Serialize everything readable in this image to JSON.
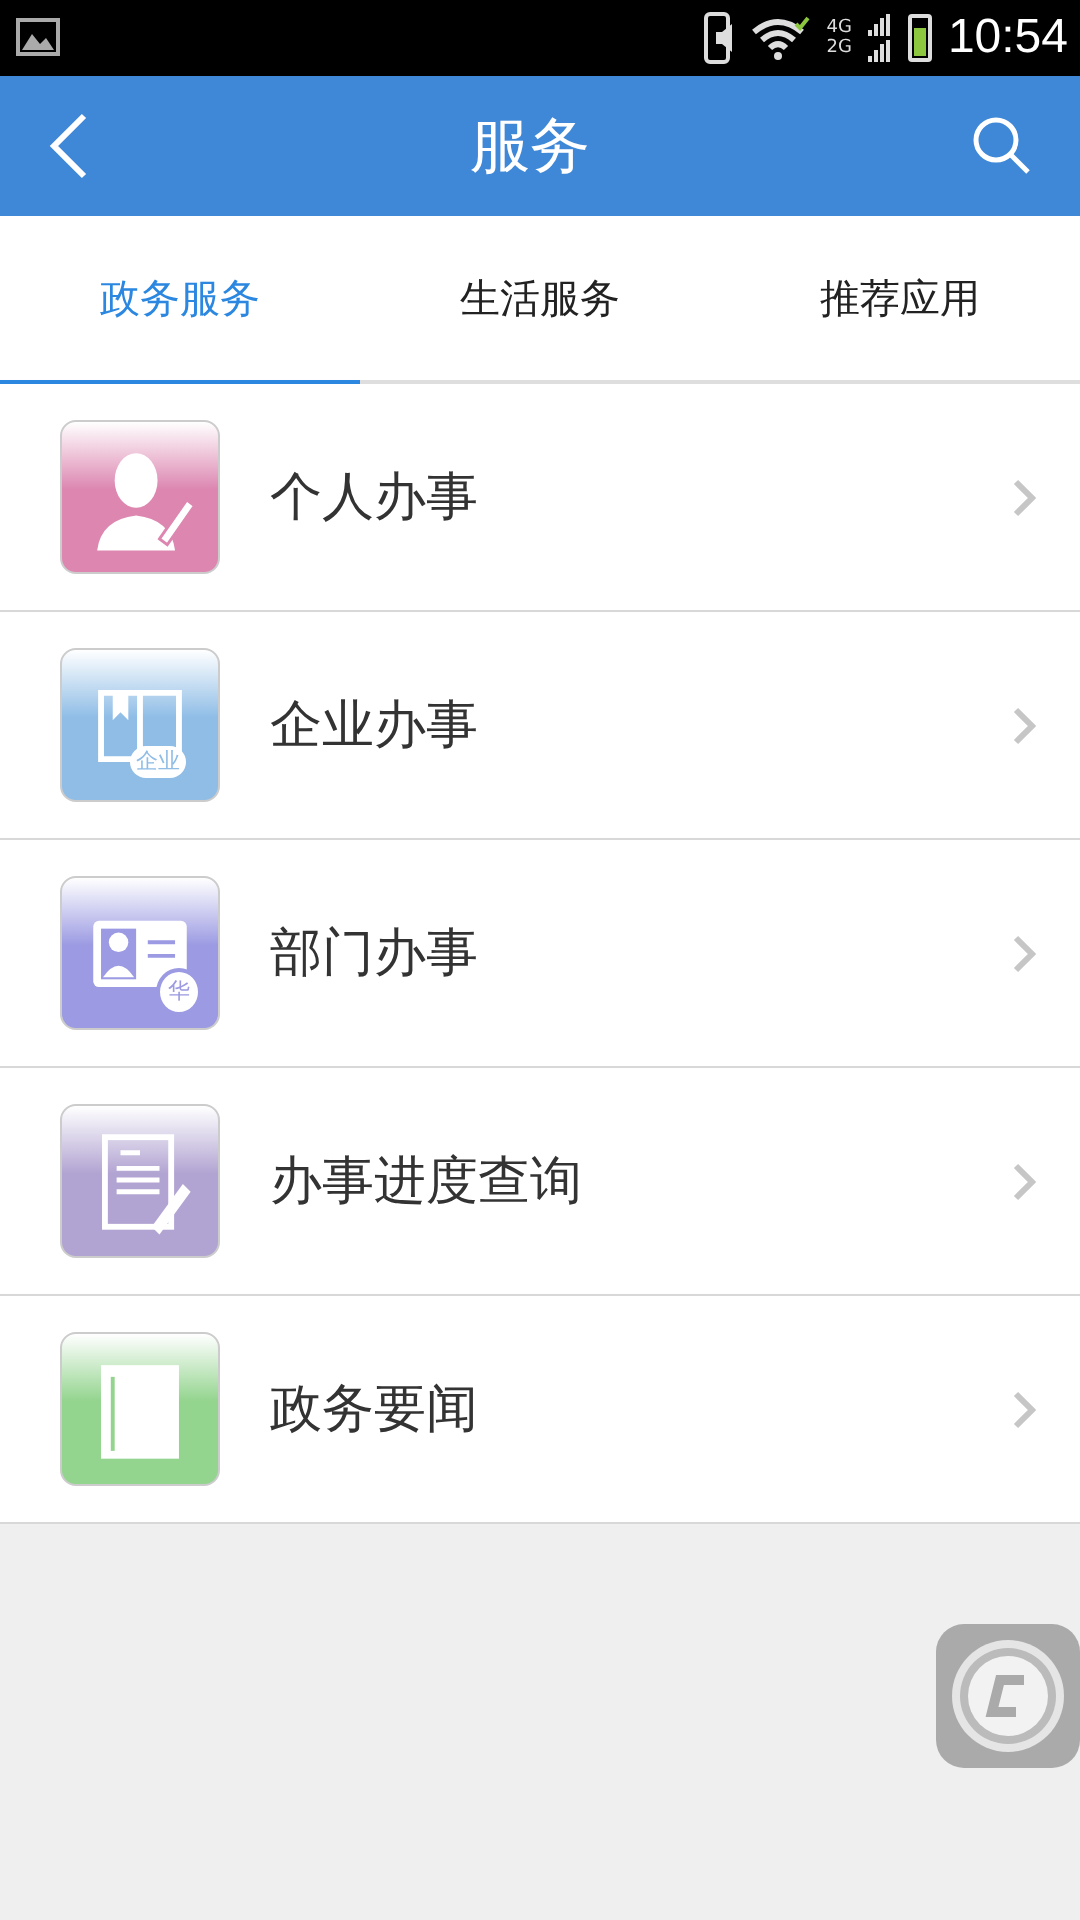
{
  "status_bar": {
    "network_top": "4G",
    "network_bottom": "2G",
    "time": "10:54"
  },
  "header": {
    "title": "服务"
  },
  "tabs": [
    {
      "label": "政务服务",
      "selected": true
    },
    {
      "label": "生活服务",
      "selected": false
    },
    {
      "label": "推荐应用",
      "selected": false
    }
  ],
  "items": [
    {
      "label": "个人办事",
      "kind": "person",
      "color": "#dc86b0"
    },
    {
      "label": "企业办事",
      "kind": "book",
      "color": "#8fbde6",
      "badge": "企业"
    },
    {
      "label": "部门办事",
      "kind": "card",
      "color": "#9b9ae2",
      "badge": "华"
    },
    {
      "label": "办事进度查询",
      "kind": "document",
      "color": "#b2a4d2"
    },
    {
      "label": "政务要闻",
      "kind": "news",
      "color": "#93d48e"
    }
  ]
}
